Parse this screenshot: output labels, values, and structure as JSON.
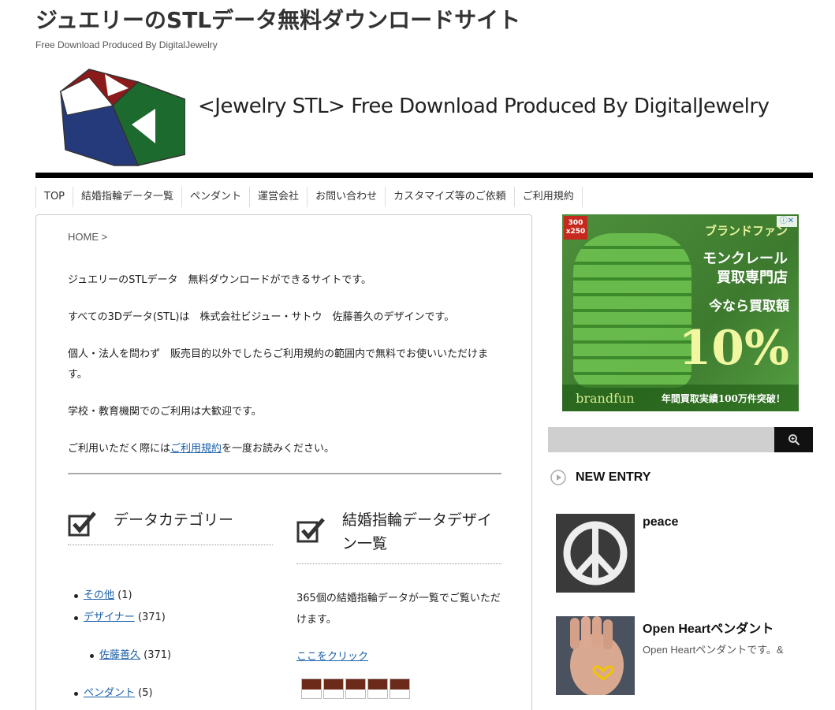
{
  "site": {
    "title": "ジュエリーのSTLデータ無料ダウンロードサイト",
    "tagline": "Free Download Produced By DigitalJewelry",
    "banner_text": "<Jewelry STL>  Free Download  Produced By DigitalJewelry"
  },
  "nav": {
    "items": [
      "TOP",
      "結婚指輪データ一覧",
      "ペンダント",
      "運営会社",
      "お問い合わせ",
      "カスタマイズ等のご依頼",
      "ご利用規約"
    ]
  },
  "main": {
    "breadcrumb": "HOME >",
    "intro": {
      "p1": "ジュエリーのSTLデータ　無料ダウンロードができるサイトです。",
      "p2": "すべての3Dデータ(STL)は　株式会社ビジュー・サトウ　佐藤善久のデザインです。",
      "p3": "個人・法人を問わず　販売目的以外でしたらご利用規約の範囲内で無料でお使いいただけます。",
      "p4": "学校・教育機関でのご利用は大歓迎です。",
      "p5_before": "ご利用いただく際には",
      "p5_link": "ご利用規約",
      "p5_after": "を一度お読みください。"
    },
    "categories": {
      "title": "データカテゴリー",
      "items": [
        {
          "label": "その他",
          "count": "(1)"
        },
        {
          "label": "デザイナー",
          "count": "(371)"
        },
        {
          "label": "佐藤善久",
          "count": "(371)"
        },
        {
          "label": "ペンダント",
          "count": "(5)"
        }
      ]
    },
    "rings": {
      "title": "結婚指輪データデザイン一覧",
      "description": "365個の結婚指輪データが一覧でご覧いただけます。",
      "link": "ここをクリック"
    }
  },
  "sidebar": {
    "ad": {
      "badge": "300 x250",
      "close": "ⓘ✕",
      "brand": "ブランドファン",
      "line1": "モンクレール",
      "line2": "買取専門店",
      "line3": "今なら買取額",
      "big": "10%",
      "bottom_brand": "brandfun",
      "bottom_text": "年間買取実績100万件突破！"
    },
    "search": {
      "placeholder": ""
    },
    "new_entry": {
      "title": "NEW ENTRY",
      "entries": [
        {
          "title": "peace",
          "excerpt": ""
        },
        {
          "title": "Open Heartペンダント",
          "excerpt": "Open Heartペンダントです。&"
        }
      ]
    }
  },
  "colors": {
    "link": "#1a5fa8",
    "logo_red": "#8b1a1a",
    "logo_green": "#1d6a2e",
    "logo_navy": "#253a7a"
  }
}
